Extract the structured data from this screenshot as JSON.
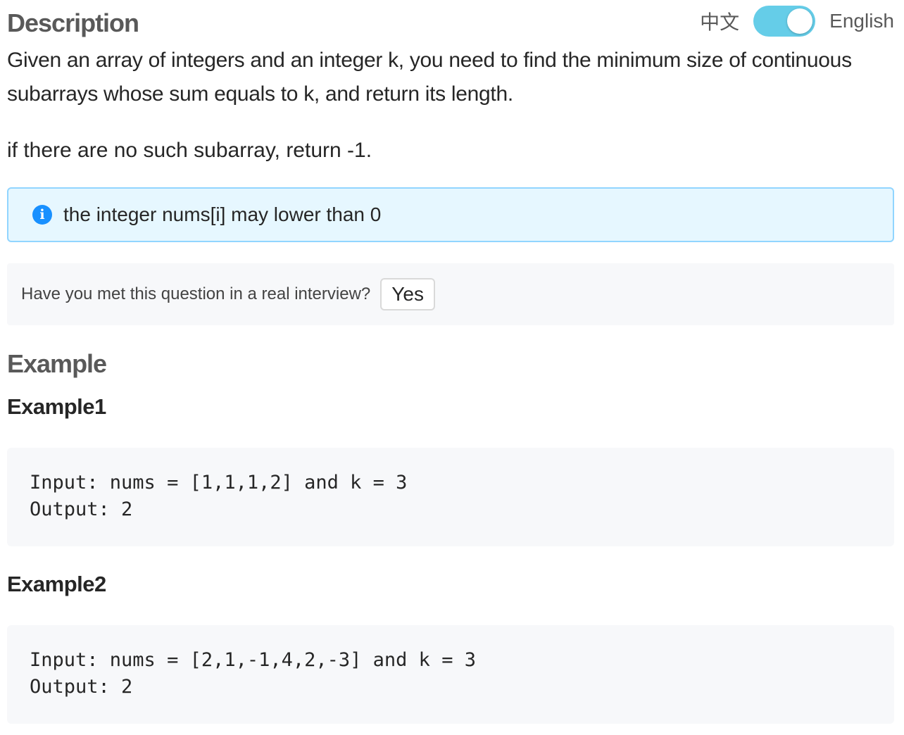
{
  "header": {
    "title": "Description",
    "lang_zh": "中文",
    "lang_en": "English",
    "toggle_on": true,
    "toggle_color": "#65cde8"
  },
  "description": {
    "paragraph1": "Given an array of integers and an integer k, you need to find the minimum size of continuous subarrays whose sum equals to k, and return its length.",
    "paragraph2": "if there are no such subarray, return -1."
  },
  "notice": {
    "icon": "info-icon",
    "text": "the integer nums[i] may lower than 0",
    "color": "#1890ff"
  },
  "interview": {
    "question": "Have you met this question in a real interview?",
    "yes_label": "Yes"
  },
  "examples": {
    "heading": "Example",
    "items": [
      {
        "title": "Example1",
        "input": "Input: nums = [1,1,1,2] and k = 3",
        "output": "Output: 2"
      },
      {
        "title": "Example2",
        "input": "Input: nums = [2,1,-1,4,2,-3] and k = 3",
        "output": "Output: 2"
      }
    ]
  }
}
